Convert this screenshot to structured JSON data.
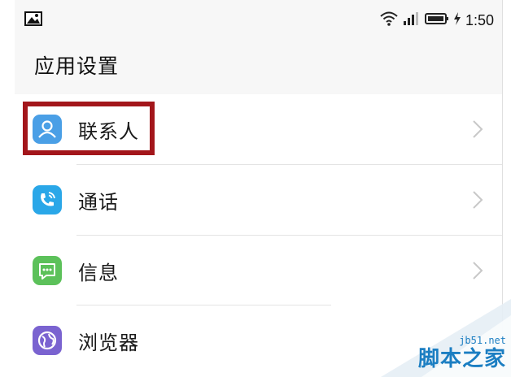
{
  "status_bar": {
    "time": "1:50",
    "icons": [
      "image-icon",
      "wifi-icon",
      "signal-icon",
      "battery-icon",
      "charging-icon"
    ]
  },
  "header": {
    "title": "应用设置"
  },
  "list": {
    "items": [
      {
        "label": "联系人",
        "icon": "contacts-icon",
        "color": "#4a9fe6",
        "highlighted": true
      },
      {
        "label": "通话",
        "icon": "phone-icon",
        "color": "#2aa7e8"
      },
      {
        "label": "信息",
        "icon": "message-icon",
        "color": "#5cc15a"
      },
      {
        "label": "浏览器",
        "icon": "browser-icon",
        "color": "#7a63d0"
      }
    ]
  },
  "annotation": {
    "color": "#a3161b"
  },
  "watermark": {
    "site": "jb51.net",
    "name": "脚本之家",
    "color": "#1b7ec2"
  }
}
